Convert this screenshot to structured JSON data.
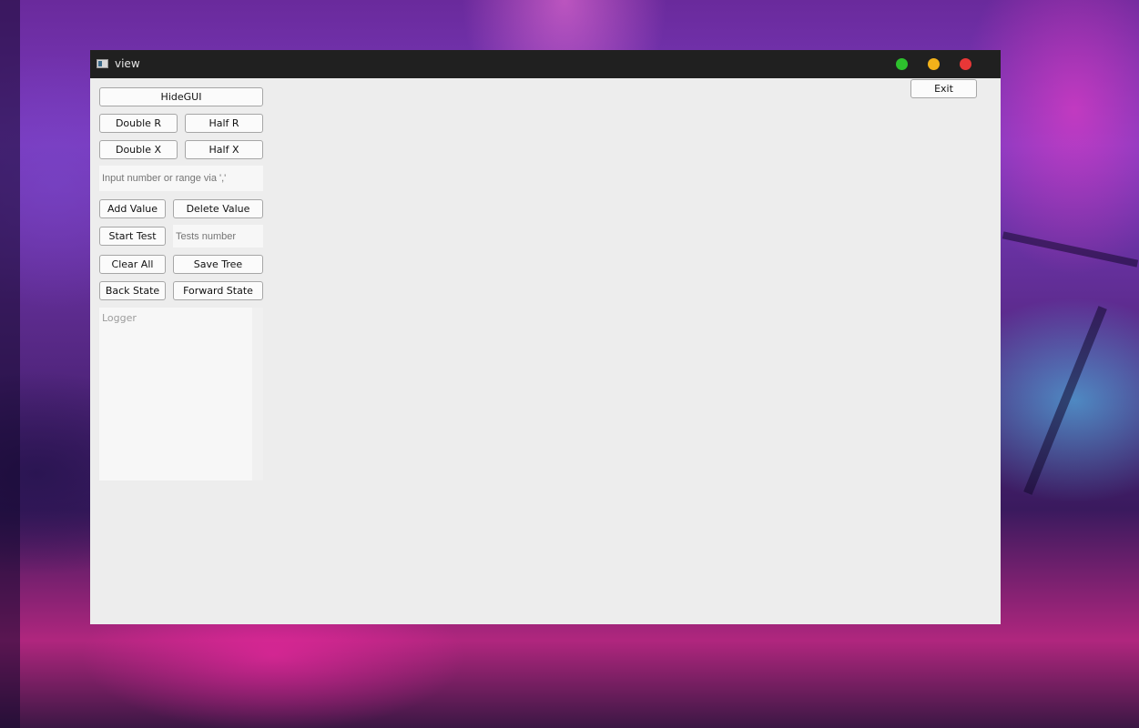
{
  "window": {
    "title": "view"
  },
  "toolbar": {
    "exit_label": "Exit"
  },
  "controls": {
    "hide_gui_label": "HideGUI",
    "double_r_label": "Double R",
    "half_r_label": "Half R",
    "double_x_label": "Double X",
    "half_x_label": "Half X",
    "value_input": {
      "value": "",
      "placeholder": "Input number or range via ','"
    },
    "add_value_label": "Add Value",
    "delete_value_label": "Delete Value",
    "start_test_label": "Start Test",
    "tests_input": {
      "value": "",
      "placeholder": "Tests number"
    },
    "clear_all_label": "Clear All",
    "save_tree_label": "Save Tree",
    "back_state_label": "Back State",
    "forward_state_label": "Forward State"
  },
  "logger": {
    "placeholder": "Logger"
  },
  "colors": {
    "titlebar": "#202020",
    "window_bg": "#ededed",
    "maximize_dot": "#2dc02d",
    "minimize_dot": "#f3b21a",
    "close_dot": "#e83737"
  }
}
